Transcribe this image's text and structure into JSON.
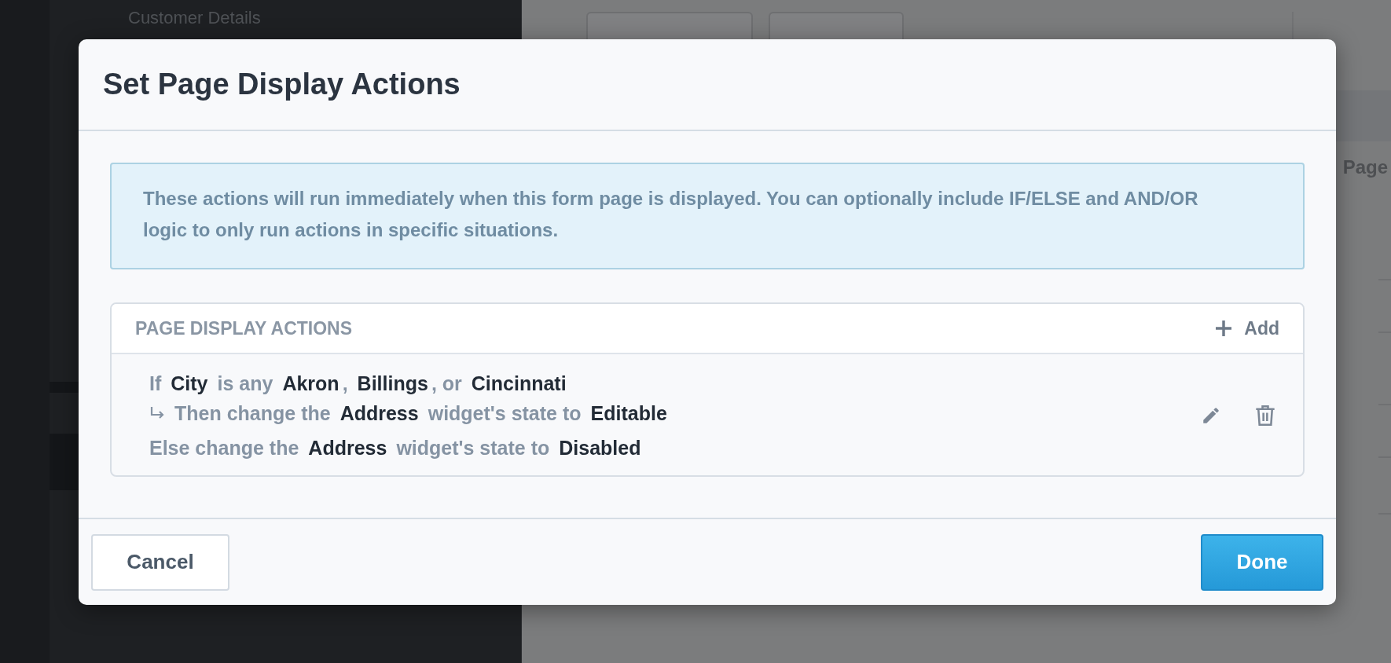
{
  "background": {
    "sidebar_title": "Customer Details",
    "panel_heading": "Page"
  },
  "dialog": {
    "title": "Set Page Display Actions",
    "info": "These actions will run immediately when this form page is displayed. You can optionally include IF/ELSE and AND/OR logic to only run actions in specific situations.",
    "section": {
      "title": "PAGE DISPLAY ACTIONS",
      "add_label": "Add"
    },
    "rule_lines": [
      {
        "kind": "if",
        "segments": [
          {
            "kind": "keyword",
            "text": "If"
          },
          {
            "kind": "value",
            "text": "City"
          },
          {
            "kind": "keyword",
            "text": "is any"
          },
          {
            "kind": "value",
            "text": "Akron"
          },
          {
            "kind": "separator",
            "text": ","
          },
          {
            "kind": "value",
            "text": "Billings"
          },
          {
            "kind": "separator",
            "text": ", or"
          },
          {
            "kind": "value",
            "text": "Cincinnati"
          }
        ]
      },
      {
        "kind": "then",
        "segments": [
          {
            "kind": "keyword",
            "text": "Then change the"
          },
          {
            "kind": "value",
            "text": "Address"
          },
          {
            "kind": "keyword",
            "text": "widget's state to"
          },
          {
            "kind": "value",
            "text": "Editable"
          }
        ]
      },
      {
        "kind": "else",
        "segments": [
          {
            "kind": "keyword",
            "text": "Else change the"
          },
          {
            "kind": "value",
            "text": "Address"
          },
          {
            "kind": "keyword",
            "text": "widget's state to"
          },
          {
            "kind": "value",
            "text": "Disabled"
          }
        ]
      }
    ],
    "buttons": [
      {
        "label": "Cancel",
        "kind": "secondary"
      },
      {
        "label": "Done",
        "kind": "primary"
      }
    ]
  }
}
